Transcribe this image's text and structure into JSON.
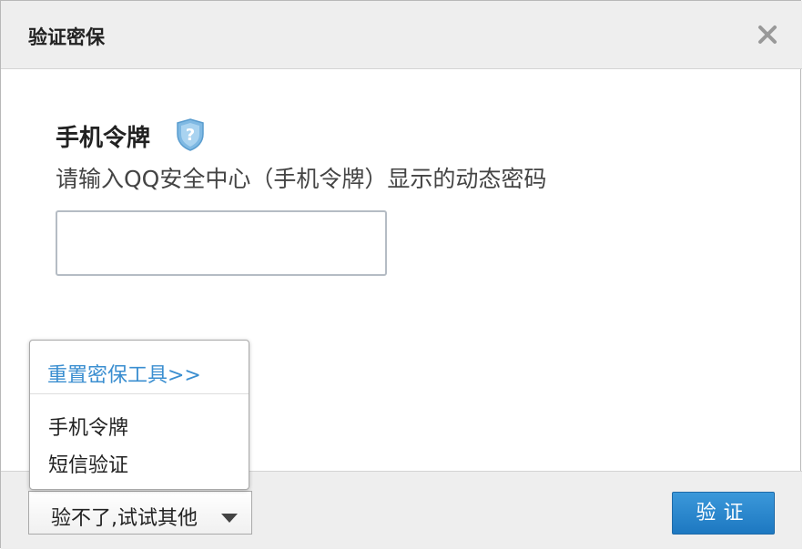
{
  "dialog": {
    "title": "验证密保",
    "close_icon": "close-icon"
  },
  "method": {
    "title": "手机令牌",
    "icon": "shield-question-icon",
    "instructions": "请输入QQ安全中心（手机令牌）显示的动态密码",
    "code_value": "",
    "code_placeholder": ""
  },
  "dropdown": {
    "reset_link": "重置密保工具>>",
    "options": [
      "手机令牌",
      "短信验证"
    ]
  },
  "footer": {
    "alt_button_label": "验不了,试试其他",
    "verify_label": "验证"
  },
  "colors": {
    "link": "#3a8ed0",
    "primary_button": "#1d78c1",
    "header_bg": "#eeeeee"
  }
}
